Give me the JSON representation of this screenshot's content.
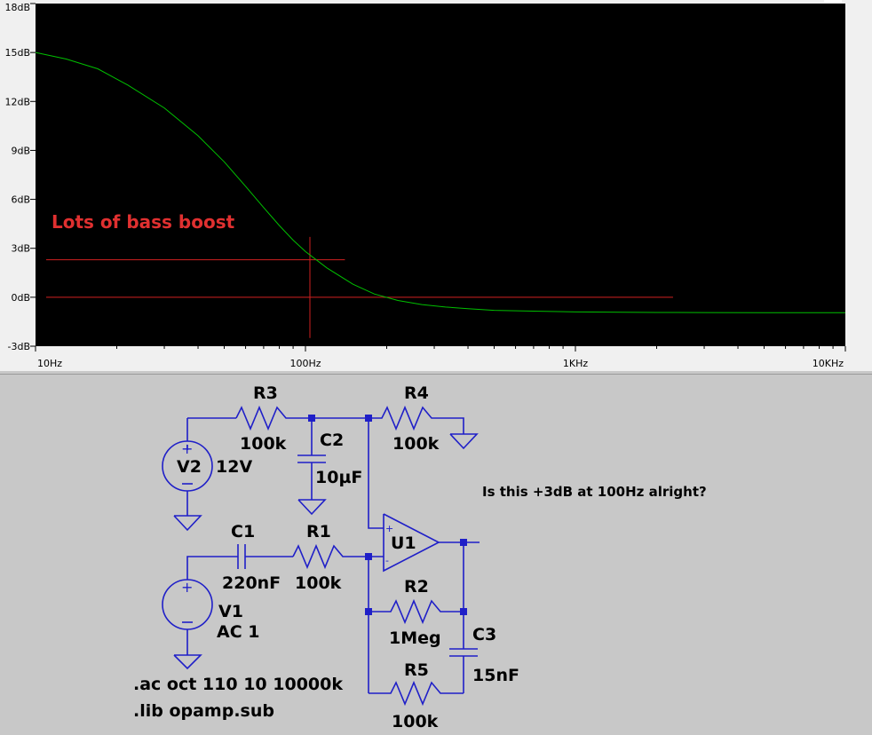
{
  "plot": {
    "annotation": "Lots of bass boost",
    "colors": {
      "background": "#000000",
      "trace": "#00c000",
      "cursor": "#d02020"
    },
    "y_ticks": [
      "18dB",
      "15dB",
      "12dB",
      "9dB",
      "6dB",
      "3dB",
      "0dB",
      "-3dB"
    ],
    "x_ticks": [
      "10Hz",
      "100Hz",
      "1KHz",
      "10KHz"
    ]
  },
  "chart_data": {
    "type": "line",
    "x_scale": "log",
    "xlim": [
      10,
      10000
    ],
    "ylim": [
      -3,
      18
    ],
    "grid": false,
    "series": [
      {
        "x": [
          10,
          13,
          17,
          22,
          30,
          40,
          50,
          60,
          70,
          80,
          90,
          100,
          120,
          150,
          180,
          220,
          270,
          330,
          400,
          500,
          700,
          1000,
          1500,
          2000,
          3000,
          5000,
          7000,
          10000
        ],
        "y": [
          15.0,
          14.6,
          14.0,
          13.0,
          11.6,
          9.9,
          8.3,
          6.8,
          5.5,
          4.4,
          3.5,
          2.8,
          1.8,
          0.8,
          0.2,
          -0.2,
          -0.45,
          -0.6,
          -0.7,
          -0.8,
          -0.85,
          -0.9,
          -0.92,
          -0.93,
          -0.94,
          -0.95,
          -0.95,
          -0.95
        ]
      }
    ],
    "annotations": [
      {
        "text": "Lots of bass boost"
      },
      {
        "type": "hline",
        "y": 2.3,
        "x_range": [
          10,
          140
        ]
      },
      {
        "type": "hline",
        "y": 0,
        "x_range": [
          10,
          2300
        ]
      },
      {
        "type": "vline",
        "x": 100,
        "y_range": [
          -2.5,
          3.7
        ]
      }
    ]
  },
  "schematic": {
    "labels": {
      "r3": "R3",
      "r3v": "100k",
      "r4": "R4",
      "r4v": "100k",
      "c2": "C2",
      "c2v": "10µF",
      "v2": "V2",
      "v2v": "12V",
      "c1": "C1",
      "c1v": "220nF",
      "r1": "R1",
      "r1v": "100k",
      "u1": "U1",
      "r2": "R2",
      "r2v": "1Meg",
      "c3": "C3",
      "c3v": "15nF",
      "r5": "R5",
      "r5v": "100k",
      "v1": "V1",
      "v1v": "AC 1"
    },
    "directives": [
      ".ac oct 110 10 10000k",
      ".lib opamp.sub"
    ],
    "question": "Is this +3dB at 100Hz alright?",
    "colors": {
      "wire": "#1f1fc8",
      "background": "#c8c8c8"
    }
  }
}
